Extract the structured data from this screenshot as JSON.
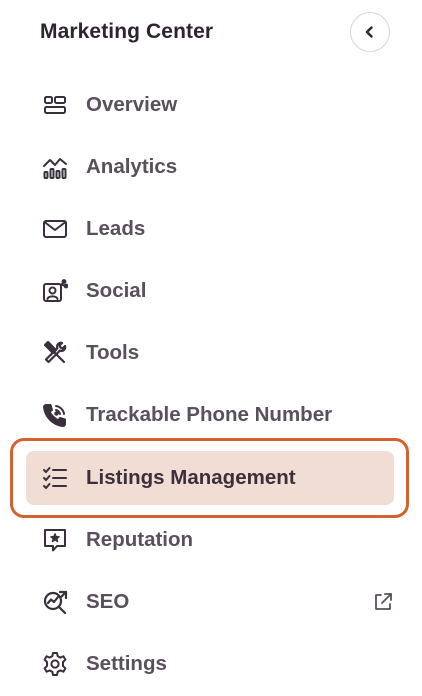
{
  "sidebar": {
    "title": "Marketing Center",
    "collapse_icon": "chevron-left-icon",
    "items": [
      {
        "label": "Overview",
        "icon": "grid-layout-icon"
      },
      {
        "label": "Analytics",
        "icon": "chart-trend-icon"
      },
      {
        "label": "Leads",
        "icon": "mail-icon"
      },
      {
        "label": "Social",
        "icon": "social-share-icon"
      },
      {
        "label": "Tools",
        "icon": "tools-icon"
      },
      {
        "label": "Trackable Phone Number",
        "icon": "phone-tracking-icon"
      },
      {
        "label": "Listings Management",
        "icon": "checklist-icon",
        "active": true
      },
      {
        "label": "Reputation",
        "icon": "star-chat-icon"
      },
      {
        "label": "SEO",
        "icon": "search-chart-icon",
        "external_icon": "external-link-icon"
      },
      {
        "label": "Settings",
        "icon": "gear-icon"
      }
    ]
  },
  "colors": {
    "active_background": "#f1ddd4",
    "active_outline": "#d4622f",
    "text": "#5a4f5c",
    "title": "#2f2331"
  }
}
